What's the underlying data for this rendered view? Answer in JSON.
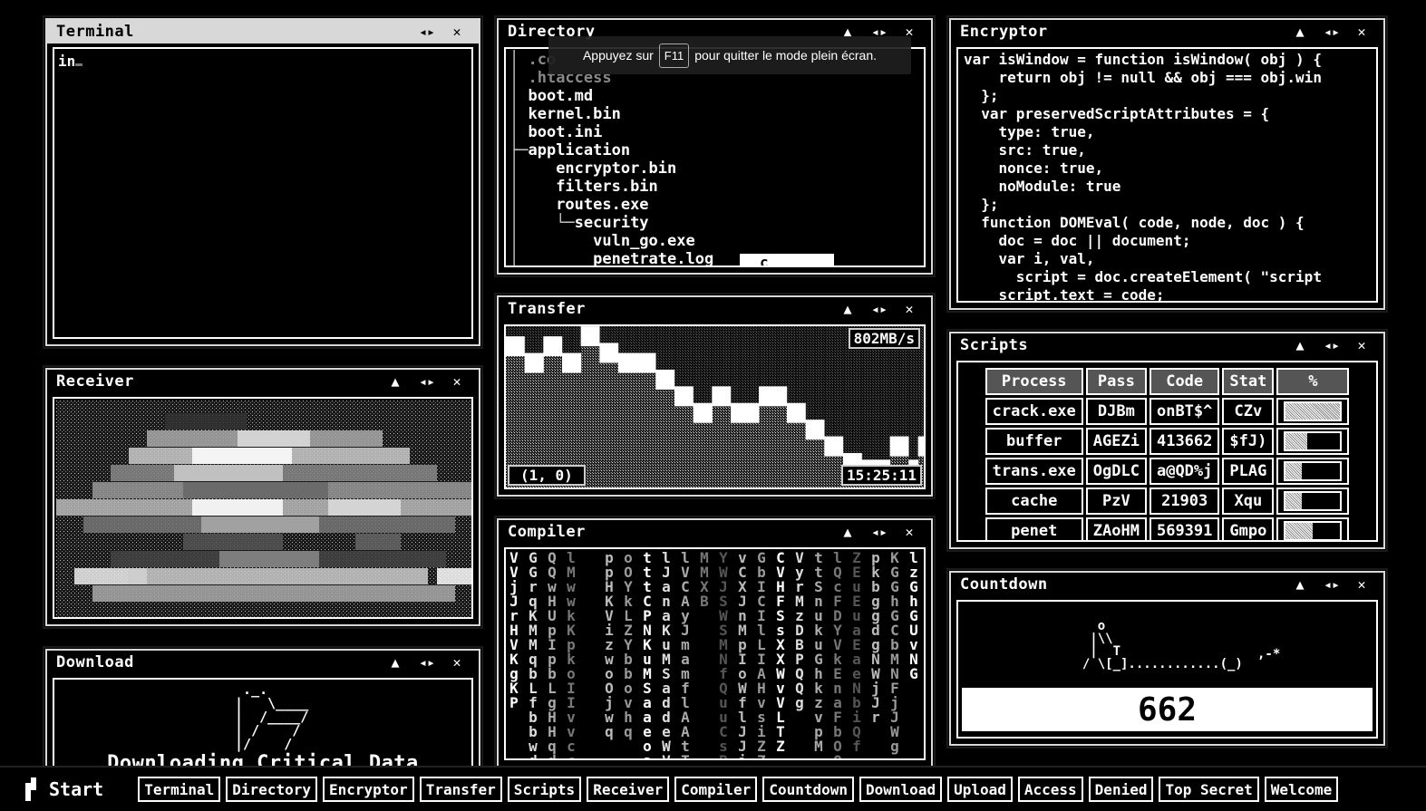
{
  "windows": {
    "terminal": {
      "title": "Terminal",
      "input": "in"
    },
    "directory": {
      "title": "Directory",
      "rows": [
        {
          "prefix": "│ ",
          "name": ".co",
          "dim": true
        },
        {
          "prefix": "│ ",
          "name": ".htaccess",
          "dim": true
        },
        {
          "prefix": "│ ",
          "name": "boot.md",
          "dim": false
        },
        {
          "prefix": "│ ",
          "name": "kernel.bin",
          "dim": false
        },
        {
          "prefix": "│ ",
          "name": "boot.ini",
          "dim": false
        },
        {
          "prefix": "├─",
          "name": "application",
          "dim": false
        },
        {
          "prefix": "│    ",
          "name": "encryptor.bin",
          "dim": false
        },
        {
          "prefix": "│    ",
          "name": "filters.bin",
          "dim": false
        },
        {
          "prefix": "│    ",
          "name": "routes.exe",
          "dim": false
        },
        {
          "prefix": "│    └─",
          "name": "security",
          "dim": false
        },
        {
          "prefix": "│        ",
          "name": "vuln_go.exe",
          "dim": false
        },
        {
          "prefix": "│        ",
          "name": "penetrate.log",
          "dim": false
        }
      ],
      "input_value": "c",
      "toast": {
        "before": "Appuyez sur",
        "key": "F11",
        "after": "pour quitter le mode plein écran."
      }
    },
    "encryptor": {
      "title": "Encryptor",
      "code": [
        "var isWindow = function isWindow( obj ) {",
        "    return obj != null && obj === obj.win",
        "  };",
        "  var preservedScriptAttributes = {",
        "    type: true,",
        "    src: true,",
        "    nonce: true,",
        "    noModule: true",
        "  };",
        "  function DOMEval( code, node, doc ) {",
        "    doc = doc || document;",
        "    var i, val,",
        "      script = doc.createElement( \"script",
        "    script.text = code;"
      ]
    },
    "transfer": {
      "title": "Transfer",
      "rate": "802MB/s",
      "coords": "(1, 0)",
      "time": "15:25:11",
      "levels": [
        0.82,
        0.82,
        0.72,
        0.72,
        0.82,
        0.82,
        0.72,
        0.72,
        0.88,
        0.88,
        0.78,
        0.78,
        0.72,
        0.72,
        0.72,
        0.72,
        0.62,
        0.62,
        0.52,
        0.52,
        0.42,
        0.42,
        0.52,
        0.52,
        0.42,
        0.42,
        0.42,
        0.52,
        0.52,
        0.52,
        0.42,
        0.42,
        0.32,
        0.32,
        0.22,
        0.22,
        0.12,
        0.12,
        0.08,
        0.08,
        0.08,
        0.22,
        0.22,
        0.08,
        0.22
      ]
    },
    "scripts": {
      "title": "Scripts",
      "headers": [
        "Process",
        "Pass",
        "Code",
        "Stat",
        "%"
      ],
      "rows": [
        {
          "process": "crack.exe",
          "pass": "DJBm",
          "code": "onBT$^",
          "stat": "CZv",
          "pct": 1.0
        },
        {
          "process": "buffer",
          "pass": "AGEZi",
          "code": "413662",
          "stat": "$fJ)",
          "pct": 0.4
        },
        {
          "process": "trans.exe",
          "pass": "OgDLC",
          "code": "a@QD%j",
          "stat": "PLAG",
          "pct": 0.3
        },
        {
          "process": "cache",
          "pass": "PzV",
          "code": "21903",
          "stat": "Xqu",
          "pct": 0.3
        },
        {
          "process": "penet",
          "pass": "ZAoHM",
          "code": "569391",
          "stat": "Gmpo",
          "pct": 0.5
        }
      ]
    },
    "countdown": {
      "title": "Countdown",
      "value": "662",
      "art": "    o\n   |\\\\\n   |  T\n  / \\[_]............(_)",
      "art_tail": ",-*"
    },
    "receiver": {
      "title": "Receiver"
    },
    "compiler": {
      "title": "Compiler",
      "columns": [
        "VVjJrHVKgKP",
        "GGrqKMMqbLfbbwd",
        "QQwHUpIpbLgHHqd",
        "lMwwkKpkoIIvvcc",
        "",
        "pp  HKVizwoOjwq",
        "oOYkLZYbbovhq",
        "tttCPNKuMSaaeoa",
        "lJanaKuMSaddeWV",
        "lVCAyJmamflAAtT",
        "MMXB",
        "YWJSWSMNfQuuCsB",
        "vCXJnMpIoWflJJi",
        "GbICIlLIAHvsiZZ",
        "CVHFSsXXWvVLTZ",
        "VyrMzDBPQQg",
        "ttSnukuGhkzvpM",
        "lQcFDYVkEnaFbOO",
        "ZEuEuaEaeNbiQf",
        "pkbggdgNWjJr",
        "KGGhGCbMNFjJWg",
        "lzGhGUvNG"
      ]
    },
    "download": {
      "title": "Download",
      "text": "Downloading Critical Data",
      "art": "  ._.\n |   \\____\n |  /____/\n | /    /\n |/    /"
    }
  },
  "taskbar": {
    "start": "Start",
    "items": [
      "Terminal",
      "Directory",
      "Encryptor",
      "Transfer",
      "Scripts",
      "Receiver",
      "Compiler",
      "Countdown",
      "Download",
      "Upload",
      "Access",
      "Denied",
      "Top Secret",
      "Welcome"
    ]
  }
}
